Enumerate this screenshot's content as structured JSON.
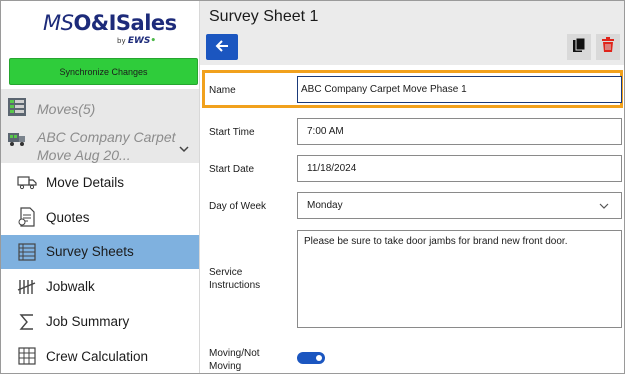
{
  "app": {
    "logo_ms": "MS",
    "logo_rest": "O&ISales",
    "logo_by": "by",
    "logo_ews_pre": "EWS",
    "logo_ews_dot": "•"
  },
  "sidebar": {
    "sync_label": "Synchronize Changes",
    "moves_label": "Moves(5)",
    "company_label": "ABC Company Carpet Move Aug 20...",
    "items": [
      {
        "label": "Move Details",
        "icon": "truck-icon"
      },
      {
        "label": "Quotes",
        "icon": "quote-document-icon"
      },
      {
        "label": "Survey Sheets",
        "icon": "survey-sheet-icon",
        "active": true
      },
      {
        "label": "Jobwalk",
        "icon": "tally-icon"
      },
      {
        "label": "Job Summary",
        "icon": "sigma-icon"
      },
      {
        "label": "Crew Calculation",
        "icon": "grid-calculator-icon"
      }
    ]
  },
  "header": {
    "title": "Survey Sheet 1"
  },
  "form": {
    "name_label": "Name",
    "name_value": "ABC Company Carpet Move Phase 1",
    "start_time_label": "Start Time",
    "start_time_value": "7:00 AM",
    "start_date_label": "Start Date",
    "start_date_value": "11/18/2024",
    "day_label": "Day of Week",
    "day_value": "Monday",
    "instructions_label": "Service Instructions",
    "instructions_value": "Please be sure to take door jambs for brand new front door.",
    "moving_label": "Moving/Not Moving",
    "moving_on": true
  },
  "colors": {
    "accent_blue": "#1b56c0",
    "sync_green": "#2fcc3b",
    "active_nav": "#7fb1df",
    "highlight_orange": "#f1a11d",
    "delete_red": "#e0241b",
    "logo_navy": "#1d2b7a"
  }
}
